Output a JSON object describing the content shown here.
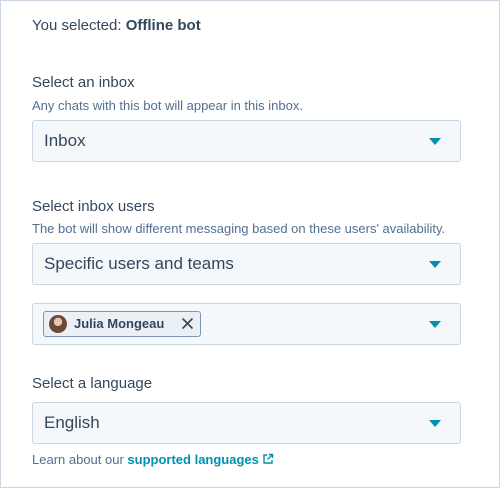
{
  "selection": {
    "prefix": "You selected:",
    "bot_name": "Offline bot"
  },
  "inbox": {
    "title": "Select an inbox",
    "help": "Any chats with this bot will appear in this inbox.",
    "value": "Inbox"
  },
  "users": {
    "title": "Select inbox users",
    "help": "The bot will show different messaging based on these users' availability.",
    "value": "Specific users and teams",
    "tags": [
      {
        "label": "Julia Mongeau"
      }
    ]
  },
  "language": {
    "title": "Select a language",
    "value": "English"
  },
  "footer": {
    "prefix": "Learn about our",
    "link": "supported languages"
  },
  "icons": {
    "caret": "caret-down-icon",
    "close": "close-icon",
    "external": "external-link-icon",
    "avatar": "user-avatar"
  },
  "colors": {
    "accent": "#0091ae",
    "text": "#33475b",
    "field_bg": "#f5f8fa",
    "border": "#cbd6e2"
  }
}
